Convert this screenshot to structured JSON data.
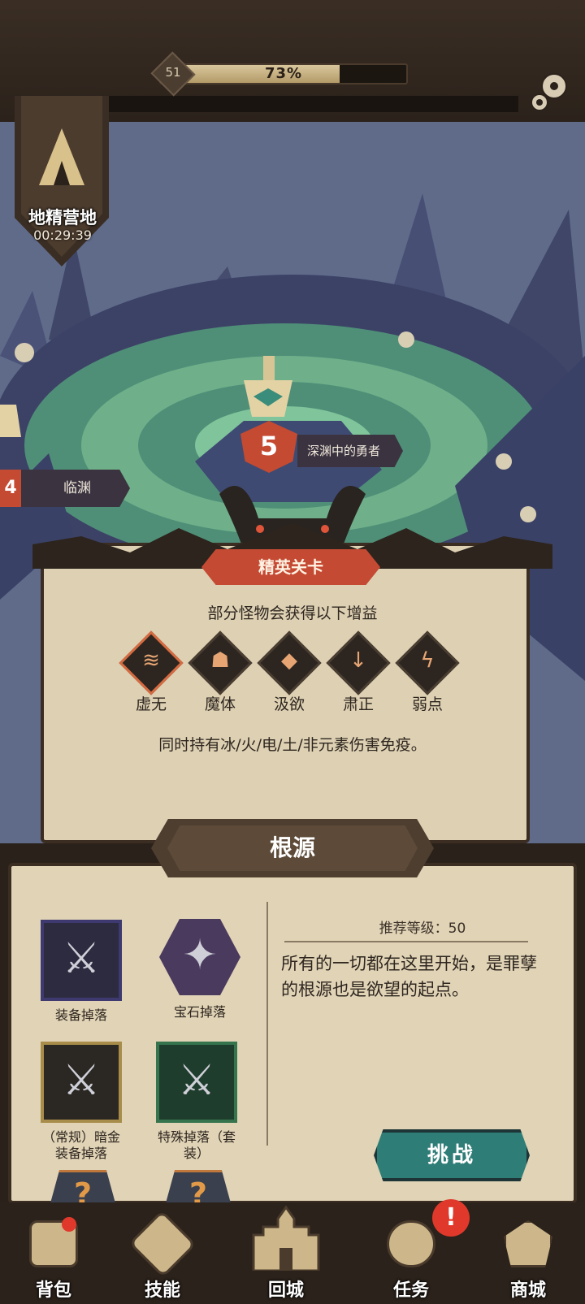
{
  "header": {
    "level": "51",
    "progress_text": "73%",
    "progress_fraction": 0.73
  },
  "camp": {
    "name": "地精营地",
    "timer": "00:29:39"
  },
  "map": {
    "current_stage_number": "5",
    "current_stage_name": "深渊中的勇者",
    "prev_stage_number": "4",
    "prev_stage_name": "临渊"
  },
  "elite": {
    "title": "精英关卡",
    "subtitle": "部分怪物会获得以下增益",
    "buffs": [
      {
        "label": "虚无",
        "icon": "void-icon"
      },
      {
        "label": "魔体",
        "icon": "demon-body-icon"
      },
      {
        "label": "汲欲",
        "icon": "drain-icon"
      },
      {
        "label": "肃正",
        "icon": "purge-icon"
      },
      {
        "label": "弱点",
        "icon": "weakness-icon"
      }
    ],
    "description": "同时持有冰/火/电/土/非元素伤害免疫。"
  },
  "stage_info": {
    "title": "根源",
    "recommended": "推荐等级：50",
    "lore": "所有的一切都在这里开始，是罪孽的根源也是欲望的起点。",
    "drops": [
      {
        "label": "装备掉落",
        "icon": "crossed-swords-icon"
      },
      {
        "label": "宝石掉落",
        "icon": "gem-icon"
      },
      {
        "label": "（常规）暗金\n装备掉落",
        "icon": "crossed-swords-icon"
      },
      {
        "label": "特殊掉落（套\n装）",
        "icon": "crossed-swords-icon"
      }
    ],
    "mystery_glyph": "?",
    "challenge_label": "挑战"
  },
  "nav": {
    "items": [
      {
        "label": "背包",
        "icon": "backpack-icon"
      },
      {
        "label": "技能",
        "icon": "skill-icon"
      },
      {
        "label": "回城",
        "icon": "castle-icon"
      },
      {
        "label": "任务",
        "icon": "quest-scroll-icon"
      },
      {
        "label": "商城",
        "icon": "shop-icon"
      }
    ],
    "alert_glyph": "!"
  },
  "colors": {
    "accent_red": "#c54a33",
    "teal_button": "#2f7d77",
    "parchment": "#ddd0b3"
  }
}
